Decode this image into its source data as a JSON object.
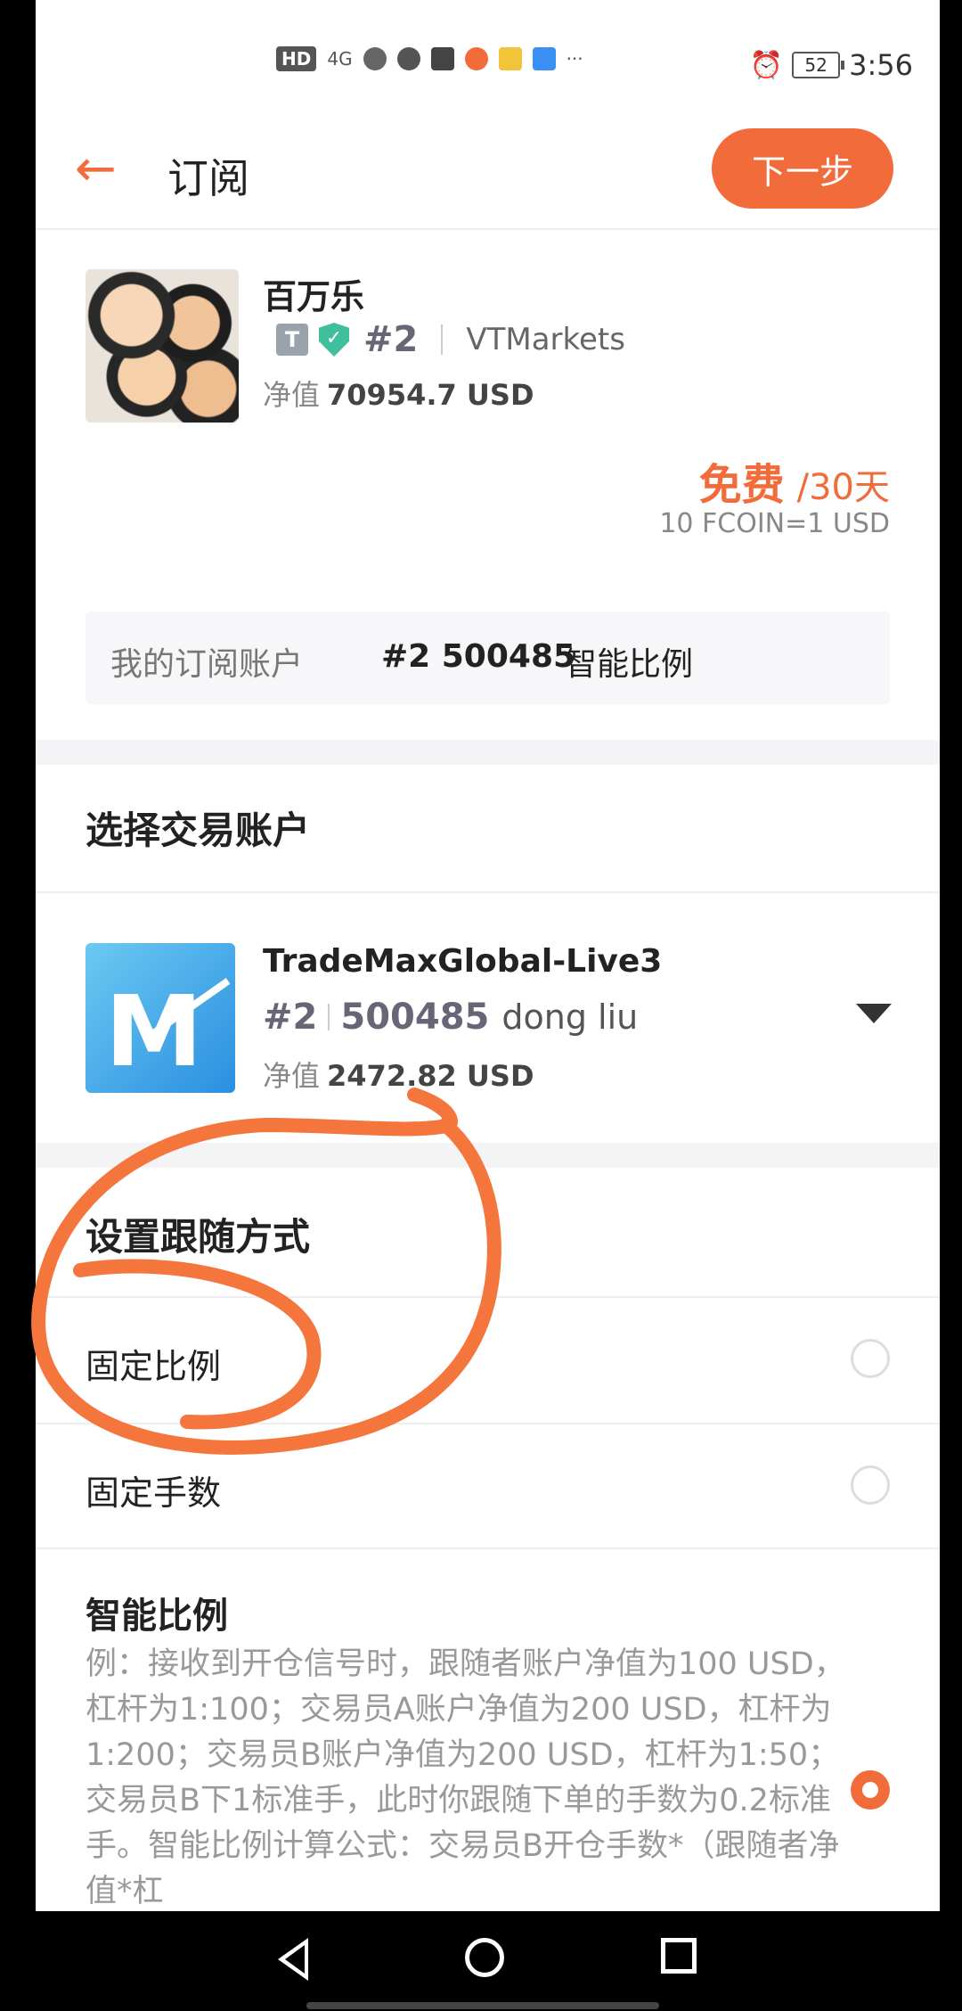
{
  "status_bar": {
    "left_badge": "HD",
    "network": "4G",
    "more": "···",
    "battery": "52",
    "time": "3:56"
  },
  "header": {
    "title": "订阅",
    "next_label": "下一步"
  },
  "trader": {
    "name": "百万乐",
    "tag_letter": "T",
    "rank": "#2",
    "broker": "VTMarkets",
    "equity_label": "净值",
    "equity_value": "70954.7 USD",
    "price": "免费",
    "period": "/30天",
    "rate": "10 FCOIN=1 USD"
  },
  "subscription": {
    "label": "我的订阅账户",
    "account": "#2 500485",
    "mode": "智能比例"
  },
  "account_section": {
    "title": "选择交易账户",
    "server": "TradeMaxGlobal-Live3",
    "rank": "#2",
    "number": "500485",
    "owner": "dong liu",
    "equity_label": "净值",
    "equity_value": "2472.82 USD"
  },
  "follow_mode": {
    "title": "设置跟随方式",
    "options": [
      {
        "label": "固定比例",
        "selected": false
      },
      {
        "label": "固定手数",
        "selected": false
      }
    ],
    "smart": {
      "title": "智能比例",
      "description": "例：接收到开仓信号时，跟随者账户净值为100 USD，杠杆为1:100；交易员A账户净值为200 USD，杠杆为1:200；交易员B账户净值为200 USD，杠杆为1:50；交易员B下1标准手，此时你跟随下单的手数为0.2标准手。智能比例计算公式：交易员B开仓手数*（跟随者净值*杠",
      "selected": true
    }
  },
  "colors": {
    "accent": "#f26b3a",
    "annotation": "#f4763d"
  }
}
